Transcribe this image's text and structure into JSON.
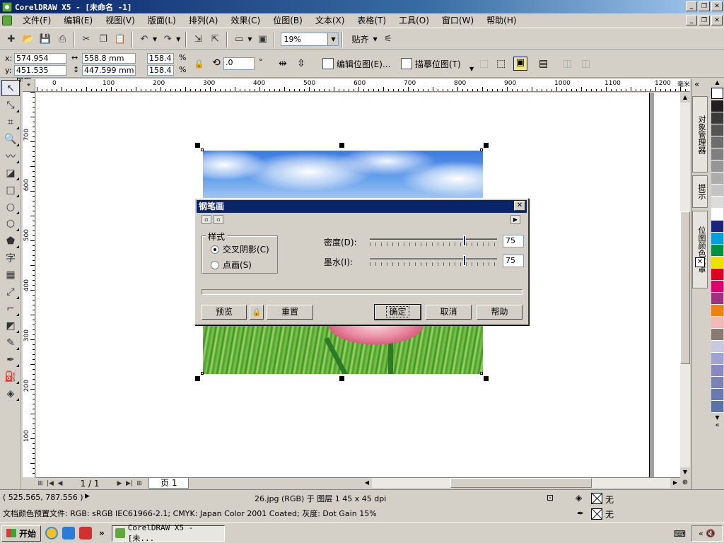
{
  "window": {
    "title": "CorelDRAW X5 - [未命名 -1]",
    "controls": [
      "_",
      "❐",
      "✕"
    ]
  },
  "menu": {
    "items": [
      "文件(F)",
      "编辑(E)",
      "视图(V)",
      "版面(L)",
      "排列(A)",
      "效果(C)",
      "位图(B)",
      "文本(X)",
      "表格(T)",
      "工具(O)",
      "窗口(W)",
      "帮助(H)"
    ]
  },
  "toolbar": {
    "zoom": "19%",
    "snap_label": "贴齐"
  },
  "propbar": {
    "x_label": "x:",
    "x_value": "574.954 mm",
    "y_label": "y:",
    "y_value": "451.535 mm",
    "w_value": "558.8 mm",
    "h_value": "447.599 mm",
    "scale_w": "158.4",
    "scale_h": "158.4",
    "percent": "%",
    "rotation": ".0",
    "degree": "°",
    "edit_bitmap": "编辑位图(E)...",
    "trace_bitmap": "描摹位图(T)"
  },
  "ruler": {
    "top_labels": [
      "0",
      "100",
      "200",
      "300",
      "400",
      "500",
      "600",
      "700",
      "800",
      "900",
      "1000",
      "1100",
      "1200"
    ],
    "left_labels": [
      "700",
      "600",
      "500",
      "400",
      "300",
      "200",
      "100"
    ],
    "unit": "毫米"
  },
  "pagebar": {
    "page_count": "1 / 1",
    "page_tab": "页 1"
  },
  "docker": {
    "tab1": "对象管理器",
    "tab2": "提示",
    "tab3": "位图颜色遮罩"
  },
  "palette": {
    "colors": [
      "#231f20",
      "#3a3a3a",
      "#555555",
      "#6d6d6d",
      "#808080",
      "#969696",
      "#adadad",
      "#c4c4c4",
      "#dcdcdc",
      "#ffffff",
      "#1a237e",
      "#00a0e0",
      "#009040",
      "#f0e000",
      "#e00020",
      "#e0006a",
      "#a03080",
      "#f08010",
      "#f4b8b8",
      "#8a7a70",
      "#c8c8e0",
      "#9fa3cf",
      "#8a88c0",
      "#7a82b8",
      "#6a7ab0",
      "#5a72a8"
    ]
  },
  "status": {
    "coords": "( 525.565, 787.556 )",
    "object_info": "26.jpg (RGB) 于 图层 1 45 x 45 dpi",
    "color_profile": "文档颜色预置文件: RGB: sRGB IEC61966-2.1; CMYK: Japan Color 2001 Coated; 灰度: Dot Gain 15%",
    "fill_none": "无",
    "outline_none": "无"
  },
  "taskbar": {
    "start": "开始",
    "task": "CorelDRAW X5 - [未..."
  },
  "dialog": {
    "title": "钢笔画",
    "style_group": "样式",
    "option_cross": "交叉阴影(C)",
    "option_dot": "点画(S)",
    "density_label": "密度(D):",
    "density_value": "75",
    "ink_label": "墨水(I):",
    "ink_value": "75",
    "preview": "预览",
    "reset": "重置",
    "ok": "确定",
    "cancel": "取消",
    "help": "帮助"
  }
}
